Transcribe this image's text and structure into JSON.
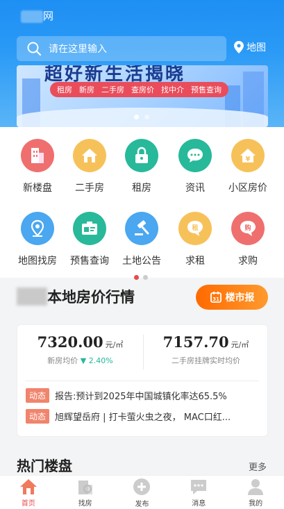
{
  "header": {
    "site_suffix": "网",
    "search_placeholder": "请在这里输入",
    "map_label": "地图"
  },
  "banner": {
    "title": "超好新生活揭晓",
    "tags": [
      "租房",
      "新房",
      "二手房",
      "查房价",
      "找中介",
      "预售查询"
    ]
  },
  "grid": [
    {
      "label": "新楼盘",
      "icon": "building-icon",
      "color": "#ef6f6f"
    },
    {
      "label": "二手房",
      "icon": "house-icon",
      "color": "#f7c15a"
    },
    {
      "label": "租房",
      "icon": "lock-icon",
      "color": "#27b99a"
    },
    {
      "label": "资讯",
      "icon": "chat-icon",
      "color": "#27b99a"
    },
    {
      "label": "小区房价",
      "icon": "yuan-house-icon",
      "color": "#f7c15a"
    },
    {
      "label": "地图找房",
      "icon": "map-pin-icon",
      "color": "#4aa7f0"
    },
    {
      "label": "预售查询",
      "icon": "id-card-icon",
      "color": "#27b99a"
    },
    {
      "label": "土地公告",
      "icon": "gavel-icon",
      "color": "#4aa7f0"
    },
    {
      "label": "求租",
      "icon": "rent-bubble-icon",
      "color": "#f7c15a"
    },
    {
      "label": "求购",
      "icon": "buy-bubble-icon",
      "color": "#ef6f6f"
    }
  ],
  "market": {
    "title": "本地房价行情",
    "report_button": "楼市报",
    "new_price": "7320.00",
    "new_unit": "元/㎡",
    "new_label": "新房均价",
    "new_change": "2.40%",
    "second_price": "7157.70",
    "second_unit": "元/㎡",
    "second_label": "二手房挂牌实时均价",
    "news_tag": "动态",
    "news": [
      "报告:预计到2025年中国城镇化率达65.5%",
      "旭辉望岳府 | 打卡萤火虫之夜， MAC口红..."
    ]
  },
  "hot": {
    "title": "热门楼盘",
    "more": "更多"
  },
  "tabbar": [
    {
      "label": "首页",
      "icon": "home-icon",
      "active": true
    },
    {
      "label": "找房",
      "icon": "find-house-icon",
      "active": false
    },
    {
      "label": "发布",
      "icon": "plus-icon",
      "active": false
    },
    {
      "label": "消息",
      "icon": "message-icon",
      "active": false
    },
    {
      "label": "我的",
      "icon": "user-icon",
      "active": false
    }
  ],
  "colors": {
    "brand": "#1e8ff4",
    "accent": "#e84b4b",
    "orange": "#ff7a1a"
  }
}
